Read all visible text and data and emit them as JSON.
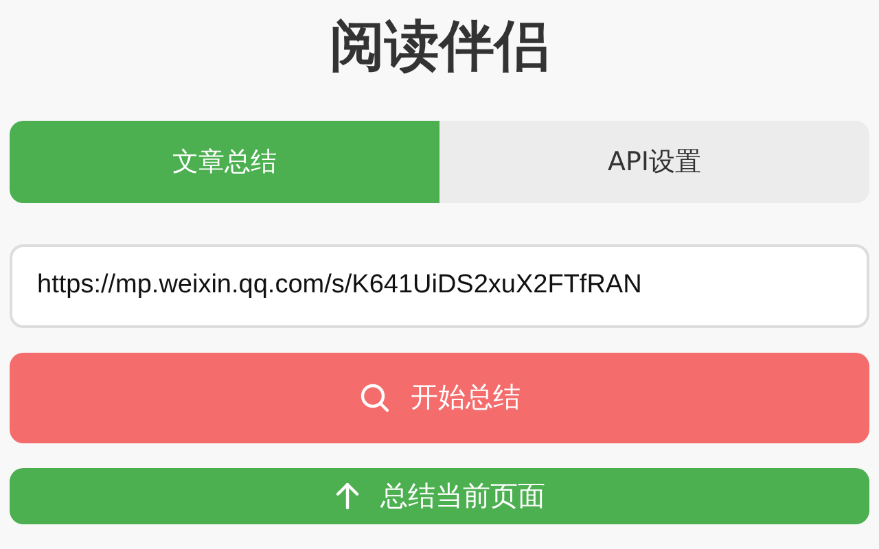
{
  "title": "阅读伴侣",
  "tabs": [
    {
      "label": "文章总结",
      "selected": true
    },
    {
      "label": "API设置",
      "selected": false
    }
  ],
  "url_field": {
    "value": "https://mp.weixin.qq.com/s/K641UiDS2xuX2FTfRAN"
  },
  "buttons": [
    {
      "kind": "search",
      "label": "开始总结"
    },
    {
      "kind": "upload",
      "label": "总结当前页面"
    }
  ]
}
